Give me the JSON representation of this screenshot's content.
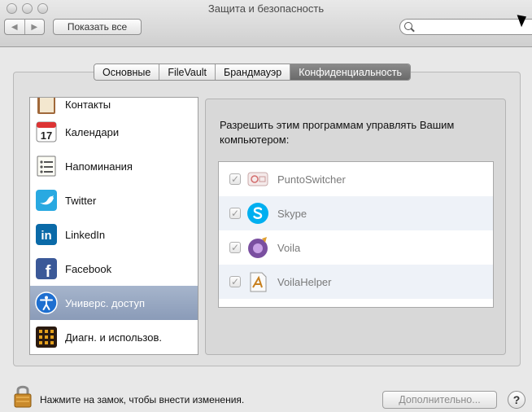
{
  "window": {
    "title": "Защита и безопасность",
    "show_all_label": "Показать все",
    "back_glyph": "◀",
    "forward_glyph": "▶"
  },
  "search": {
    "placeholder": "",
    "value": ""
  },
  "tabs": [
    {
      "label": "Основные",
      "active": false
    },
    {
      "label": "FileVault",
      "active": false
    },
    {
      "label": "Брандмауэр",
      "active": false
    },
    {
      "label": "Конфиденциальность",
      "active": true
    }
  ],
  "sidebar": {
    "items": [
      {
        "label": "Контакты",
        "icon": "contacts-icon"
      },
      {
        "label": "Календари",
        "icon": "calendar-icon",
        "icon_text": "17"
      },
      {
        "label": "Напоминания",
        "icon": "reminders-icon"
      },
      {
        "label": "Twitter",
        "icon": "twitter-icon"
      },
      {
        "label": "LinkedIn",
        "icon": "linkedin-icon",
        "icon_text": "in"
      },
      {
        "label": "Facebook",
        "icon": "facebook-icon",
        "icon_text": "f"
      },
      {
        "label": "Универс. доступ",
        "icon": "accessibility-icon",
        "selected": true
      },
      {
        "label": "Диагн. и использов.",
        "icon": "diagnostics-icon"
      }
    ]
  },
  "permissions": {
    "heading": "Разрешить этим программам управлять Вашим компьютером:",
    "apps": [
      {
        "name": "PuntoSwitcher",
        "checked": true,
        "icon": "puntoswitcher-icon"
      },
      {
        "name": "Skype",
        "checked": true,
        "icon": "skype-icon"
      },
      {
        "name": "Voila",
        "checked": true,
        "icon": "voila-icon"
      },
      {
        "name": "VoilaHelper",
        "checked": true,
        "icon": "voilahelper-icon"
      }
    ],
    "check_glyph": "✓"
  },
  "footer": {
    "lock_text": "Нажмите на замок, чтобы внести изменения.",
    "advanced_label": "Дополнительно...",
    "help_label": "?"
  },
  "colors": {
    "selection": "#8a9bb8",
    "active_tab": "#6a6a6a",
    "twitter": "#29a9e1",
    "linkedin": "#0a6aa8",
    "facebook": "#3b5998",
    "skype": "#00aff0"
  }
}
